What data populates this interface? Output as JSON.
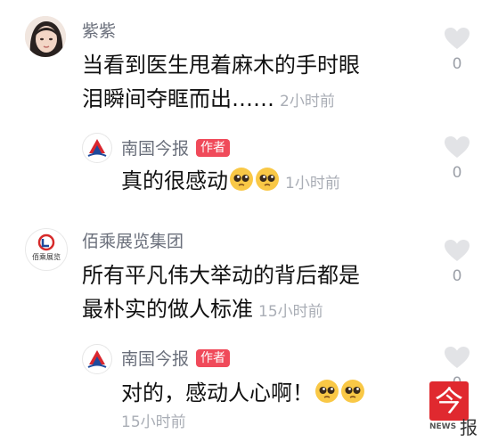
{
  "comments": [
    {
      "user": "紫紫",
      "text": "当看到医生甩着麻木的手时眼泪瞬间夺眶而出……",
      "time": "2小时前",
      "likes": "0",
      "reply": {
        "user": "南国今报",
        "badge": "作者",
        "text": "真的很感动",
        "emoji": [
          "pleading-face",
          "pleading-face"
        ],
        "time": "1小时前",
        "likes": "0"
      }
    },
    {
      "user": "佰乘展览集团",
      "avatar_text": "佰乘展览",
      "text": "所有平凡伟大举动的背后都是最朴实的做人标准",
      "time": "15小时前",
      "likes": "0",
      "reply": {
        "user": "南国今报",
        "badge": "作者",
        "text": "对的，感动人心啊！",
        "emoji": [
          "pleading-face",
          "pleading-face"
        ],
        "time": "15小时前",
        "likes": "0"
      }
    }
  ],
  "watermark": {
    "char": "今",
    "sub": "报",
    "label": "NEWS"
  },
  "colors": {
    "badge": "#f04a5a",
    "name": "#6a6f7b",
    "time": "#a9adb5",
    "heart": "#e2e3e6"
  }
}
